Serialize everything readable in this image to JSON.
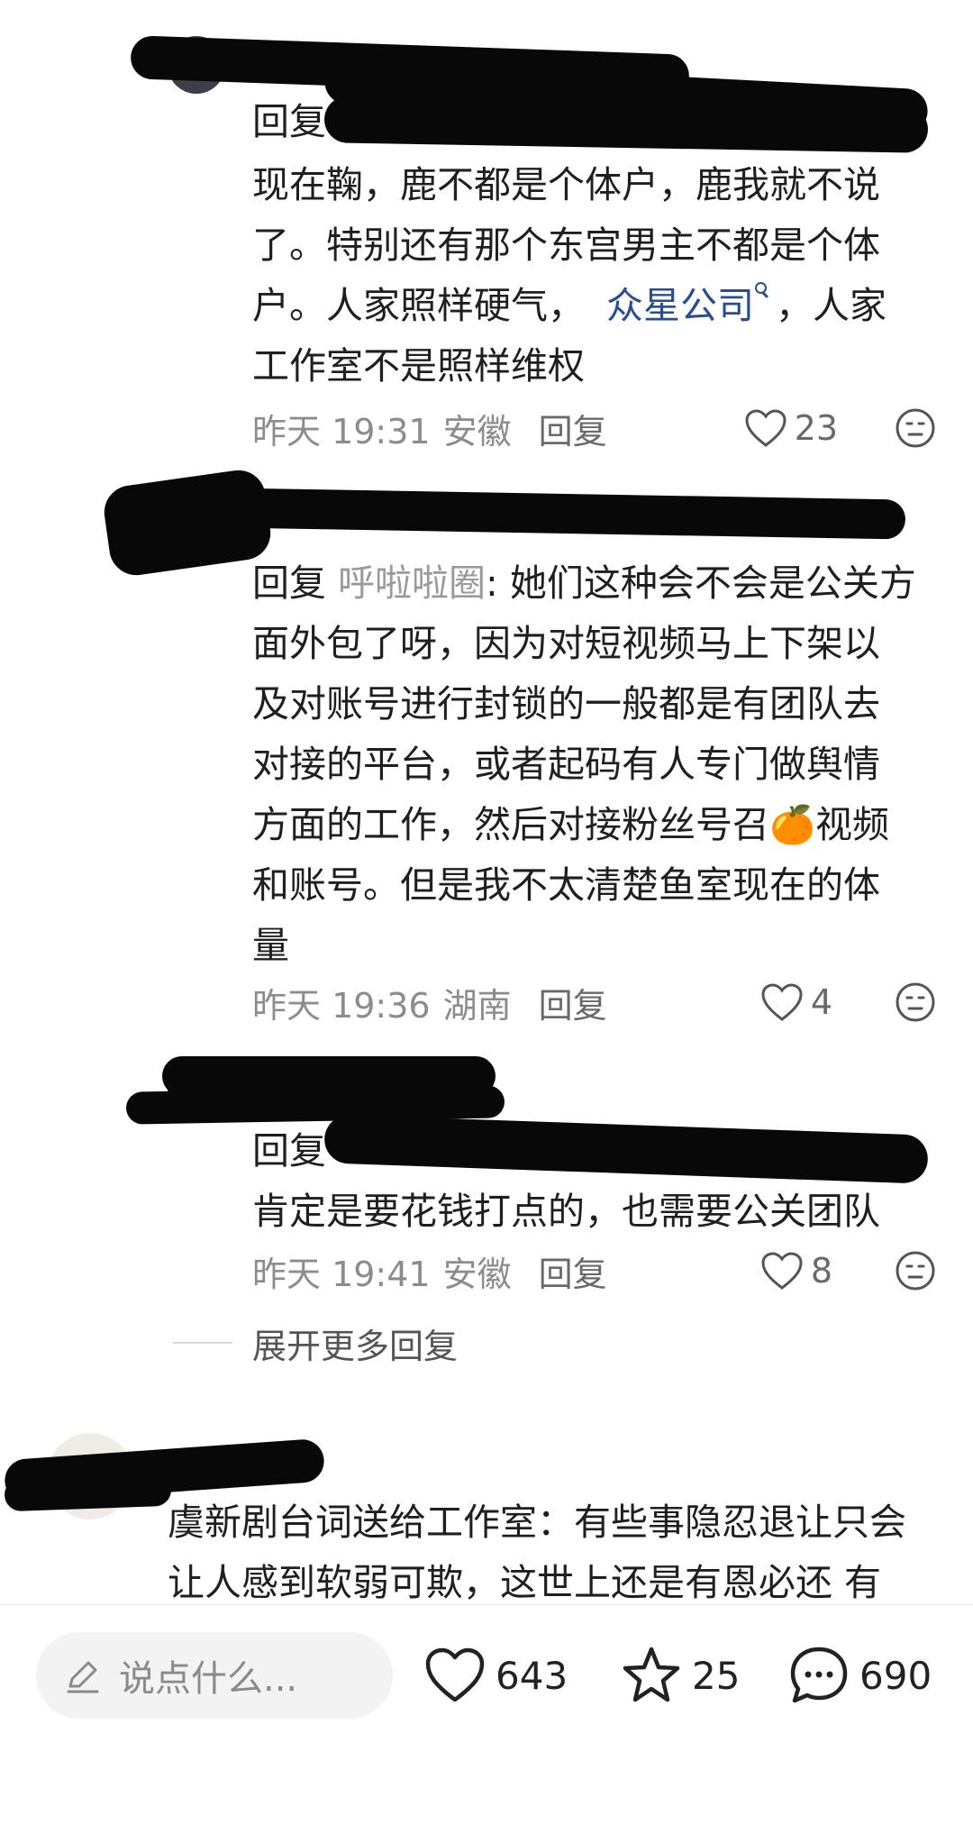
{
  "replies": [
    {
      "prefix": "回复",
      "lines": [
        "现在鞠，鹿不都是个体户，鹿我就不说",
        "了。特别还有那个东宫男主不都是个体"
      ],
      "line3_before": "户。人家照样硬气，",
      "link": "众星公司",
      "line3_after": "，人家",
      "line4": "工作室不是照样维权",
      "time": "昨天 19:31",
      "location": "安徽",
      "reply_label": "回复",
      "likes": "23"
    },
    {
      "prefix": "回复",
      "target": "呼啦啦圈",
      "lines": [
        ": 她们这种会不会是公关方",
        "面外包了呀，因为对短视频马上下架以",
        "及对账号进行封锁的一般都是有团队去",
        "对接的平台，或者起码有人专门做舆情",
        "方面的工作，然后对接粉丝号召🍊视频",
        "和账号。但是我不太清楚鱼室现在的体",
        "量"
      ],
      "time": "昨天 19:36",
      "location": "湖南",
      "reply_label": "回复",
      "likes": "4"
    },
    {
      "prefix": "回复",
      "lines": [
        "肯定是要花钱打点的，也需要公关团队"
      ],
      "time": "昨天 19:41",
      "location": "安徽",
      "reply_label": "回复",
      "likes": "8"
    }
  ],
  "expand_label": "展开更多回复",
  "main_comment": {
    "line1": "虞新剧台词送给工作室：有些事隐忍退让只会",
    "line2": "让人感到软弱可欺，这世上还是有恩必还 有"
  },
  "bottom_bar": {
    "placeholder": "说点什么...",
    "likes": "643",
    "stars": "25",
    "comments": "690"
  },
  "icons": {
    "like": "heart-outline-icon",
    "face": "neutral-face-icon",
    "pen": "pen-icon",
    "star": "star-outline-icon",
    "comment": "chat-bubble-icon"
  }
}
